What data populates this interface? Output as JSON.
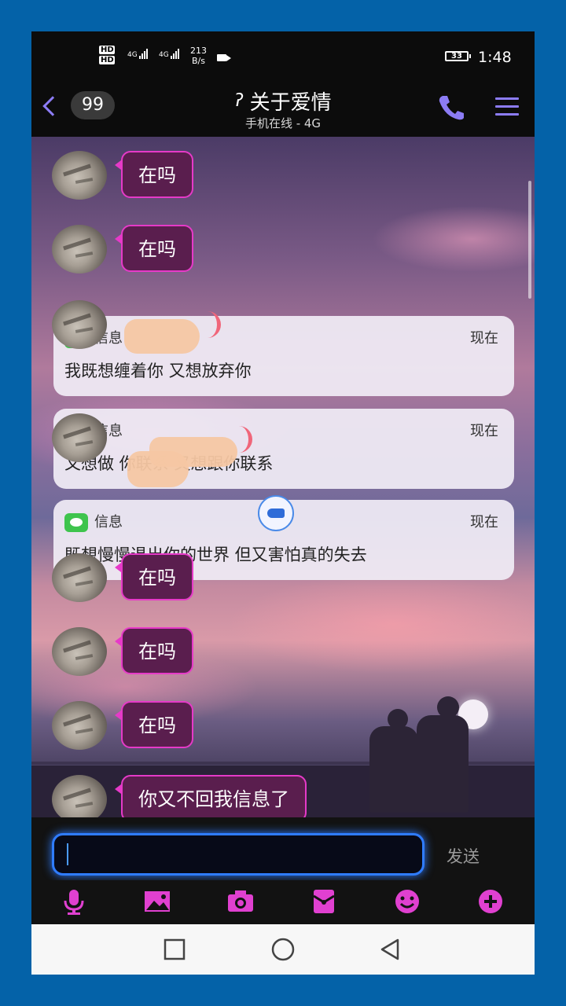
{
  "status_bar": {
    "hd1": "HD",
    "hd2": "HD",
    "net1": "4G",
    "net2": "4G",
    "speed_value": "213",
    "speed_unit": "B/s",
    "battery": "33",
    "time": "1:48"
  },
  "header": {
    "unread_count": "99",
    "contact_name": "关于爱情",
    "status": "手机在线 - 4G",
    "ear_icon": "ear-icon"
  },
  "messages": [
    {
      "text": "在吗"
    },
    {
      "text": "在吗"
    },
    {
      "text": "在吗"
    },
    {
      "text": "在吗"
    },
    {
      "text": "在吗"
    },
    {
      "text": "你又不回我信息了"
    }
  ],
  "notifications": [
    {
      "app": "信息",
      "time": "现在",
      "body": "我既想缠着你 又想放弃你"
    },
    {
      "app": "信息",
      "time": "现在",
      "body": "又想做       你联系 又想跟你联系"
    },
    {
      "app": "信息",
      "time": "现在",
      "body": "既想慢慢退出你的世界 但又害怕真的失去"
    }
  ],
  "input": {
    "value": "",
    "send_label": "发送"
  },
  "toolbar": {
    "icons": [
      "microphone-icon",
      "image-icon",
      "camera-icon",
      "red-packet-icon",
      "emoji-icon",
      "plus-icon"
    ]
  },
  "colors": {
    "accent": "#8c7cf5",
    "bubble_border": "#e63ac8",
    "bubble_fill": "#5a1e4e",
    "toolbar_icons": "#e040d0",
    "input_glow": "#2f7cff"
  }
}
